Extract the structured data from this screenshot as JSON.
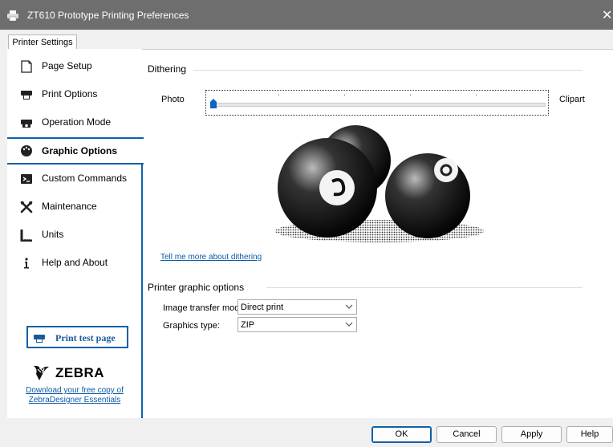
{
  "window": {
    "title": "ZT610 Prototype Printing Preferences",
    "close_glyph": "✕"
  },
  "tabs": [
    {
      "label": "Printer Settings"
    }
  ],
  "sidebar": {
    "items": [
      {
        "label": "Page Setup",
        "icon": "page-icon"
      },
      {
        "label": "Print Options",
        "icon": "printer-icon"
      },
      {
        "label": "Operation Mode",
        "icon": "printer-gear-icon"
      },
      {
        "label": "Graphic Options",
        "icon": "palette-icon",
        "active": true
      },
      {
        "label": "Custom Commands",
        "icon": "terminal-icon"
      },
      {
        "label": "Maintenance",
        "icon": "tools-icon"
      },
      {
        "label": "Units",
        "icon": "ruler-icon"
      },
      {
        "label": "Help and About",
        "icon": "info-icon"
      }
    ],
    "test_button": "Print test page",
    "brand": "ZEBRA",
    "download_line1": "Download your free copy of",
    "download_line2": "ZebraDesigner Essentials"
  },
  "dithering": {
    "title": "Dithering",
    "left_label": "Photo",
    "right_label": "Clipart",
    "link": "Tell me more about dithering"
  },
  "graphic_options": {
    "title": "Printer graphic options",
    "transfer_label": "Image transfer mode:",
    "transfer_value": "Direct print",
    "graphics_label": "Graphics type:",
    "graphics_value": "ZIP"
  },
  "buttons": {
    "ok": "OK",
    "cancel": "Cancel",
    "apply": "Apply",
    "help": "Help"
  },
  "colors": {
    "accent": "#1060a8",
    "titlebar": "#6e6e6e",
    "link": "#0b5aa6"
  }
}
